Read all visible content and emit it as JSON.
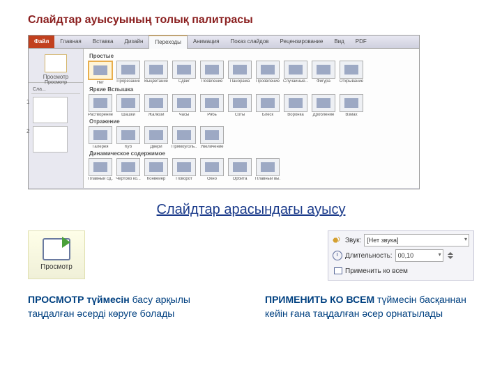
{
  "title1": "Слайдтар ауысуының толық палитрасы",
  "ribbon": {
    "file": "Файл",
    "tabs": [
      "Главная",
      "Вставка",
      "Дизайн",
      "Переходы",
      "Анимация",
      "Показ слайдов",
      "Рецензирование",
      "Вид",
      "PDF"
    ],
    "active_index": 3
  },
  "sidebar": {
    "preview_label": "Просмотр",
    "group_label": "Просмотр",
    "slides_tab": "Сла..."
  },
  "gallery": {
    "sections": [
      {
        "label": "Простые",
        "items": [
          "Нет",
          "Прорезание",
          "Выцветание",
          "Сдвиг",
          "Появление",
          "Панорама",
          "Проявление",
          "Случайные...",
          "Фигура",
          "Открывание"
        ]
      },
      {
        "label": "Яркие   Вспышка",
        "items": [
          "Растворение",
          "Шашки",
          "Жалюзи",
          "Часы",
          "Рябь",
          "Соты",
          "Блеск",
          "Воронка",
          "Дробление",
          "Взмах"
        ]
      },
      {
        "label": "Отражение",
        "items": [
          "Галерея",
          "Куб",
          "Двери",
          "Прямоуголь...",
          "Увеличение"
        ]
      },
      {
        "label": "Динамическое содержимое",
        "items": [
          "Плавный сд...",
          "Чертово ко...",
          "Конвейер",
          "Поворот",
          "Окно",
          "Орбита",
          "Плавный вы..."
        ]
      }
    ],
    "selected": {
      "section": 0,
      "item": 0
    }
  },
  "title2": "Слайдтар арасындағы ауысу",
  "preview_button_label": "Просмотр",
  "timing": {
    "sound_label": "Звук:",
    "sound_value": "[Нет звука]",
    "duration_label": "Длительность:",
    "duration_value": "00,10",
    "apply_all_label": "Применить ко всем"
  },
  "caption_left": {
    "bold": "ПРОСМОТР түймесін",
    "rest": " басу арқылы таңдалған әсерді көруге болады"
  },
  "caption_right": {
    "bold": "ПРИМЕНИТЬ КО ВСЕМ",
    "rest": " түймесін басқаннан кейін ғана таңдалған әсер орнатылады"
  }
}
